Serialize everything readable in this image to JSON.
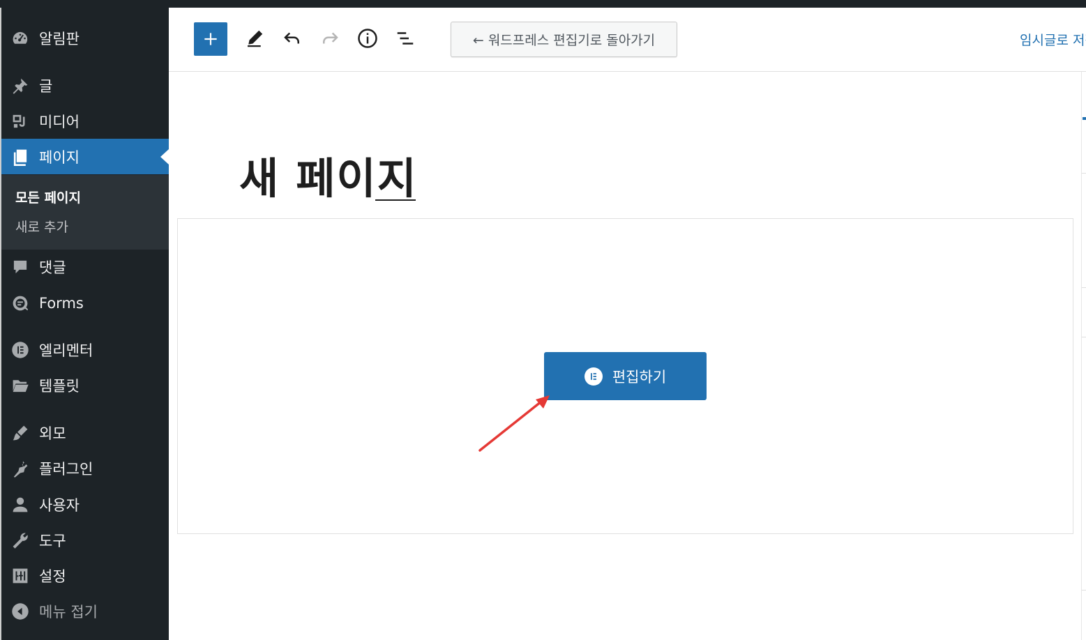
{
  "sidebar": {
    "items": [
      {
        "label": "알림판",
        "icon": "dashboard-icon"
      },
      {
        "label": "글",
        "icon": "pin-icon"
      },
      {
        "label": "미디어",
        "icon": "media-icon"
      },
      {
        "label": "페이지",
        "icon": "pages-icon",
        "active": true
      },
      {
        "label": "댓글",
        "icon": "comment-icon"
      },
      {
        "label": "Forms",
        "icon": "forms-icon"
      },
      {
        "label": "엘리멘터",
        "icon": "elementor-icon"
      },
      {
        "label": "템플릿",
        "icon": "folder-icon"
      },
      {
        "label": "외모",
        "icon": "brush-icon"
      },
      {
        "label": "플러그인",
        "icon": "plugin-icon"
      },
      {
        "label": "사용자",
        "icon": "user-icon"
      },
      {
        "label": "도구",
        "icon": "wrench-icon"
      },
      {
        "label": "설정",
        "icon": "settings-icon"
      },
      {
        "label": "메뉴 접기",
        "icon": "collapse-icon"
      }
    ],
    "submenu": [
      {
        "label": "모든 페이지",
        "current": true
      },
      {
        "label": "새로 추가"
      }
    ]
  },
  "toolbar": {
    "add_icon": "plus-icon",
    "tools": [
      "pencil-icon",
      "undo-icon",
      "redo-icon",
      "info-icon",
      "list-view-icon"
    ],
    "back_label": "← 워드프레스 편집기로 돌아가기",
    "save_draft_label": "임시글로 저장"
  },
  "page": {
    "title": "새 페이지"
  },
  "elementor": {
    "edit_label": "편집하기",
    "edit_icon": "elementor-icon"
  },
  "colors": {
    "sidebar_bg": "#1d2327",
    "accent": "#2271b1",
    "annotation_arrow": "#e53935"
  }
}
